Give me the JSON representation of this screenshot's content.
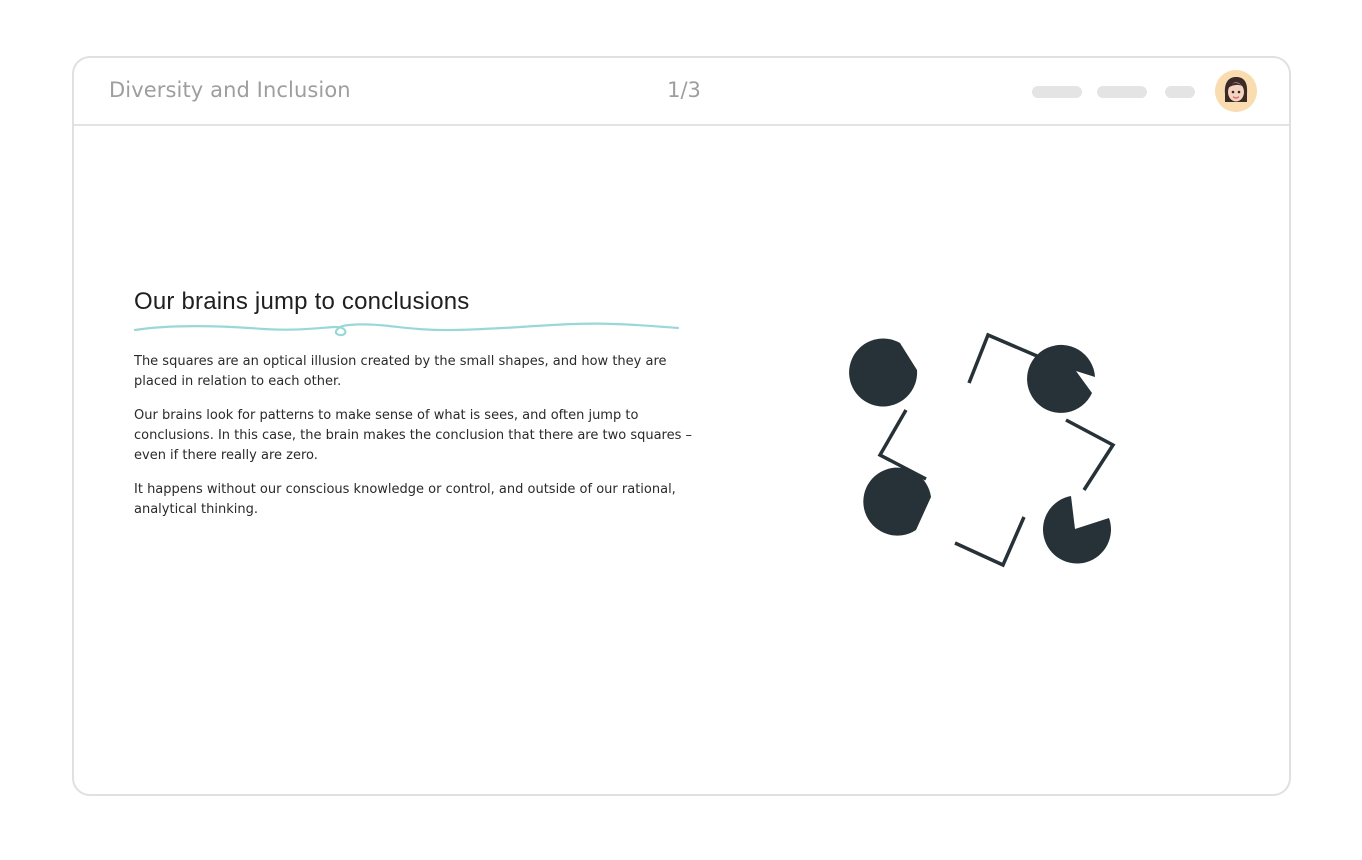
{
  "header": {
    "course_title": "Diversity and Inclusion",
    "page_counter": "1/3",
    "avatar_icon": "woman-avatar-icon"
  },
  "lesson": {
    "title": "Our brains jump to conclusions",
    "paragraphs": [
      "The squares are an optical illusion created by the small shapes, and how they are placed in relation to each other.",
      "Our brains look for patterns to make sense of what is sees, and often jump to conclusions. In this case, the brain makes the conclusion that there are two squares – even if there really are zero.",
      "It happens without our conscious knowledge or control, and outside of our rational, analytical thinking."
    ]
  },
  "colors": {
    "accent_squiggle": "#9ad8d8",
    "illusion_shapes": "#263238",
    "avatar_bg": "#f9dcb0",
    "frame_border": "#e0e0e0"
  }
}
